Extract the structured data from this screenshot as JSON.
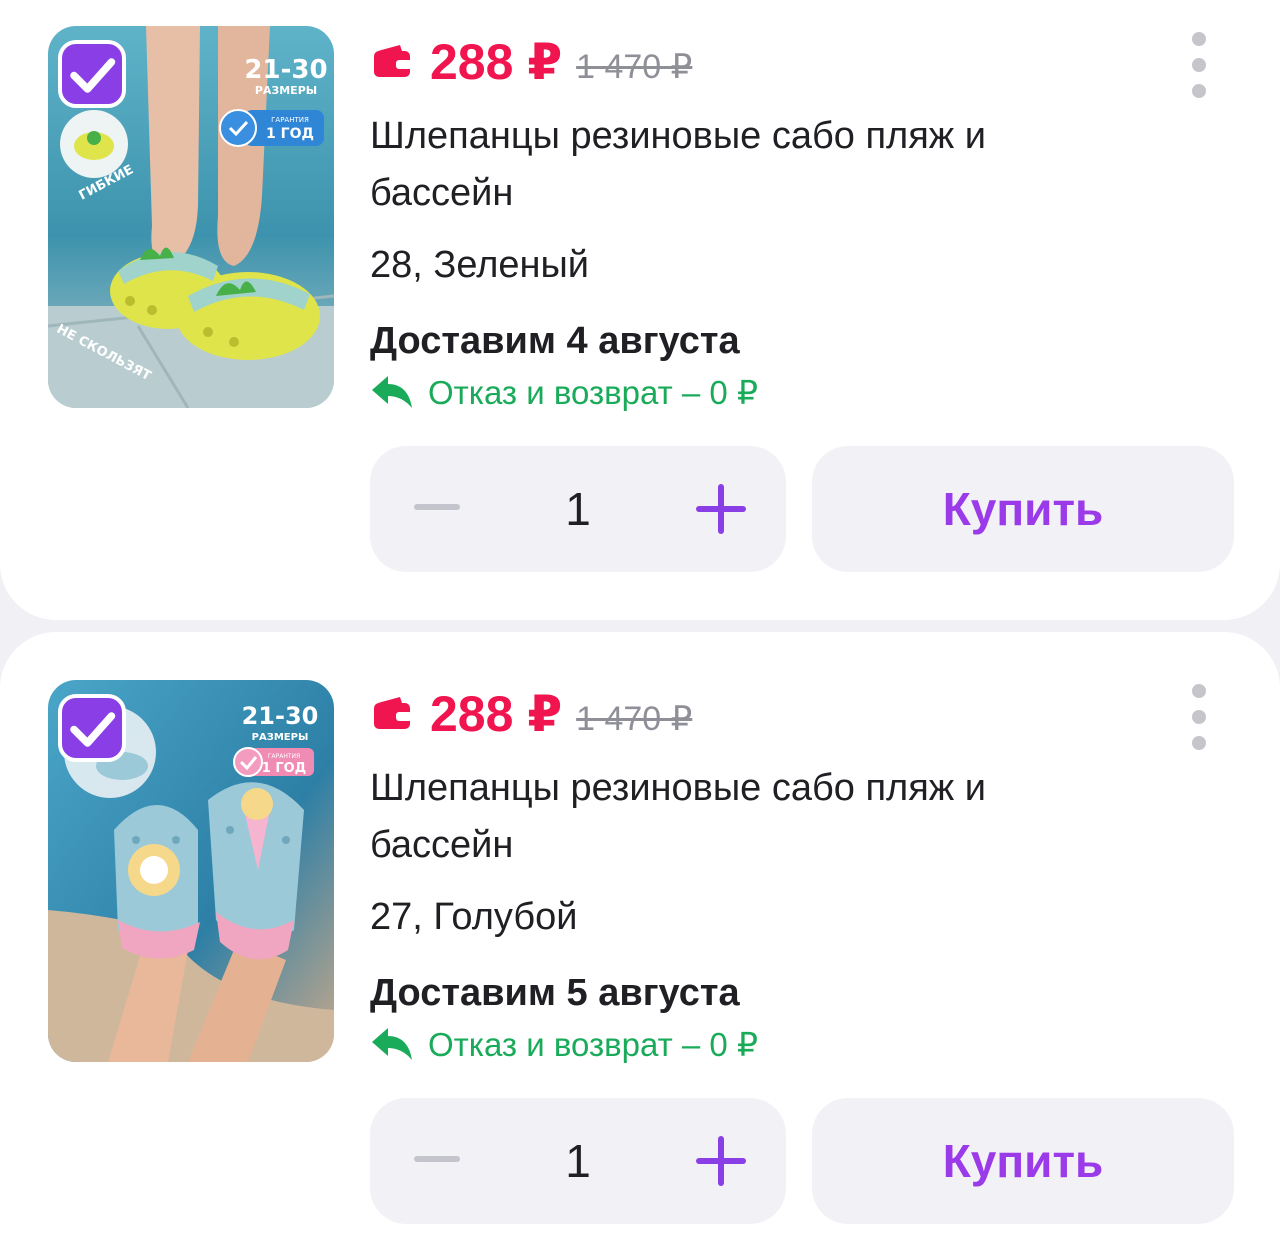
{
  "colors": {
    "price": "#f0154f",
    "accent": "#8a3fe6",
    "return_green": "#1aab5a"
  },
  "items": [
    {
      "price": "288 ₽",
      "old_price": "1 470 ₽",
      "title": "Шлепанцы резиновые сабо пляж и бассейн",
      "variant": "28, Зеленый",
      "delivery": "Доставим 4 августа",
      "return_text": "Отказ и возврат – 0 ₽",
      "quantity": "1",
      "buy_label": "Купить",
      "selected": true,
      "image_badge": {
        "sizes": "21-30",
        "sizes_caption": "РАЗМЕРЫ",
        "warranty_top": "ГАРАНТИЯ",
        "warranty": "1 ГОД"
      },
      "image_text": {
        "flexible": "ГИБКИЕ",
        "non_slip": "НЕ СКОЛЬЗЯТ"
      }
    },
    {
      "price": "288 ₽",
      "old_price": "1 470 ₽",
      "title": "Шлепанцы резиновые сабо пляж и бассейн",
      "variant": "27, Голубой",
      "delivery": "Доставим 5 августа",
      "return_text": "Отказ и возврат – 0 ₽",
      "quantity": "1",
      "buy_label": "Купить",
      "selected": true,
      "image_badge": {
        "sizes": "21-30",
        "sizes_caption": "РАЗМЕРЫ",
        "warranty_top": "ГАРАНТИЯ",
        "warranty": "1 ГОД"
      }
    }
  ]
}
